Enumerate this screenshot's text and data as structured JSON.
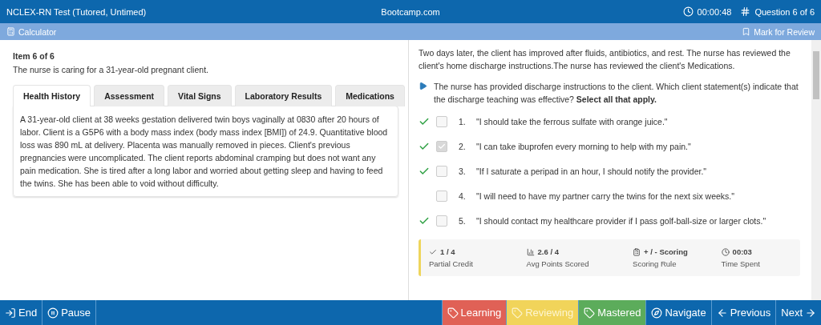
{
  "header": {
    "title": "NCLEX-RN Test (Tutored, Untimed)",
    "site": "Bootcamp.com",
    "timer": "00:00:48",
    "progress": "Question 6 of 6"
  },
  "toolbar": {
    "calculator": "Calculator",
    "mark": "Mark for Review"
  },
  "item": {
    "heading": "Item 6 of 6",
    "intro": "The nurse is caring for a 31-year-old pregnant client."
  },
  "tabs": [
    {
      "label": "Health History",
      "selected": true
    },
    {
      "label": "Assessment",
      "selected": false
    },
    {
      "label": "Vital Signs",
      "selected": false
    },
    {
      "label": "Laboratory Results",
      "selected": false
    },
    {
      "label": "Medications",
      "selected": false
    }
  ],
  "tab_content": "A 31-year-old client at 38 weeks gestation delivered twin boys vaginally at 0830 after 20 hours of labor. Client is a G5P6 with a body mass index (body mass index [BMI]) of 24.9. Quantitative blood loss was 890 mL at delivery. Placenta was manually removed in pieces. Client's previous pregnancies were uncomplicated. The client reports abdominal cramping but does not want any pain medication. She is tired after a long labor and worried about getting sleep and having to feed the twins. She has been able to void without difficulty.",
  "scenario": "Two days later, the client has improved after fluids, antibiotics, and rest. The nurse has reviewed the client's home discharge instructions.The nurse has reviewed the client's Medications.",
  "question": "The nurse has provided discharge instructions to the client. Which client statement(s) indicate that the discharge teaching was effective? **Select all that apply.**",
  "options": [
    {
      "number": "1.",
      "text": "\"I should take the ferrous sulfate with orange juice.\"",
      "correct": true,
      "checked": false
    },
    {
      "number": "2.",
      "text": "\"I can take ibuprofen every morning to help with my pain.\"",
      "correct": true,
      "checked": true
    },
    {
      "number": "3.",
      "text": "\"If I saturate a peripad in an hour, I should notify the provider.\"",
      "correct": true,
      "checked": false
    },
    {
      "number": "4.",
      "text": "\"I will need to have my partner carry the twins for the next six weeks.\"",
      "correct": false,
      "checked": false
    },
    {
      "number": "5.",
      "text": "\"I should contact my healthcare provider if I pass golf-ball-size or larger clots.\"",
      "correct": true,
      "checked": false
    }
  ],
  "stats": [
    {
      "kind": "check",
      "value": "1 / 4",
      "label": "Partial Credit"
    },
    {
      "kind": "chart",
      "value": "2.6 / 4",
      "label": "Avg Points Scored"
    },
    {
      "kind": "clipboard",
      "value": "+ / - Scoring",
      "label": "Scoring Rule"
    },
    {
      "kind": "clock",
      "value": "00:03",
      "label": "Time Spent"
    }
  ],
  "footer": {
    "left": [
      {
        "kind": "end",
        "label": "End"
      },
      {
        "kind": "pause",
        "label": "Pause"
      }
    ],
    "right": [
      {
        "kind": "learning",
        "label": "Learning"
      },
      {
        "kind": "reviewing",
        "label": "Reviewing"
      },
      {
        "kind": "mastered",
        "label": "Mastered"
      },
      {
        "kind": "navigate",
        "label": "Navigate"
      },
      {
        "kind": "previous",
        "label": "Previous"
      },
      {
        "kind": "next",
        "label": "Next"
      }
    ]
  }
}
